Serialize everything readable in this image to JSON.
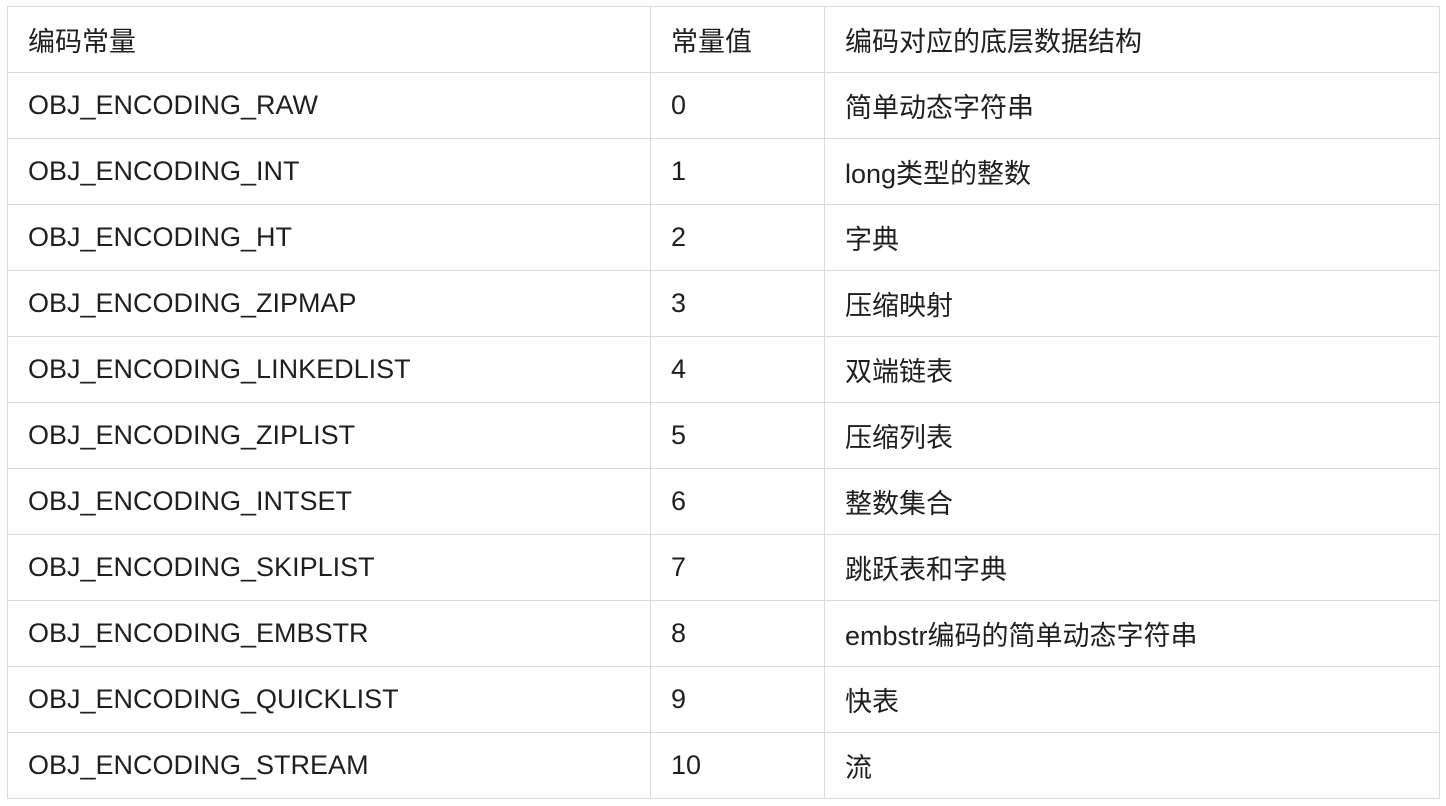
{
  "table": {
    "headers": [
      "编码常量",
      "常量值",
      "编码对应的底层数据结构"
    ],
    "rows": [
      [
        "OBJ_ENCODING_RAW",
        "0",
        "简单动态字符串"
      ],
      [
        "OBJ_ENCODING_INT",
        "1",
        "long类型的整数"
      ],
      [
        "OBJ_ENCODING_HT",
        "2",
        "字典"
      ],
      [
        "OBJ_ENCODING_ZIPMAP",
        "3",
        "压缩映射"
      ],
      [
        "OBJ_ENCODING_LINKEDLIST",
        "4",
        "双端链表"
      ],
      [
        "OBJ_ENCODING_ZIPLIST",
        "5",
        "压缩列表"
      ],
      [
        "OBJ_ENCODING_INTSET",
        "6",
        "整数集合"
      ],
      [
        "OBJ_ENCODING_SKIPLIST",
        "7",
        "跳跃表和字典"
      ],
      [
        "OBJ_ENCODING_EMBSTR",
        "8",
        "embstr编码的简单动态字符串"
      ],
      [
        "OBJ_ENCODING_QUICKLIST",
        "9",
        "快表"
      ],
      [
        "OBJ_ENCODING_STREAM",
        "10",
        "流"
      ]
    ]
  }
}
